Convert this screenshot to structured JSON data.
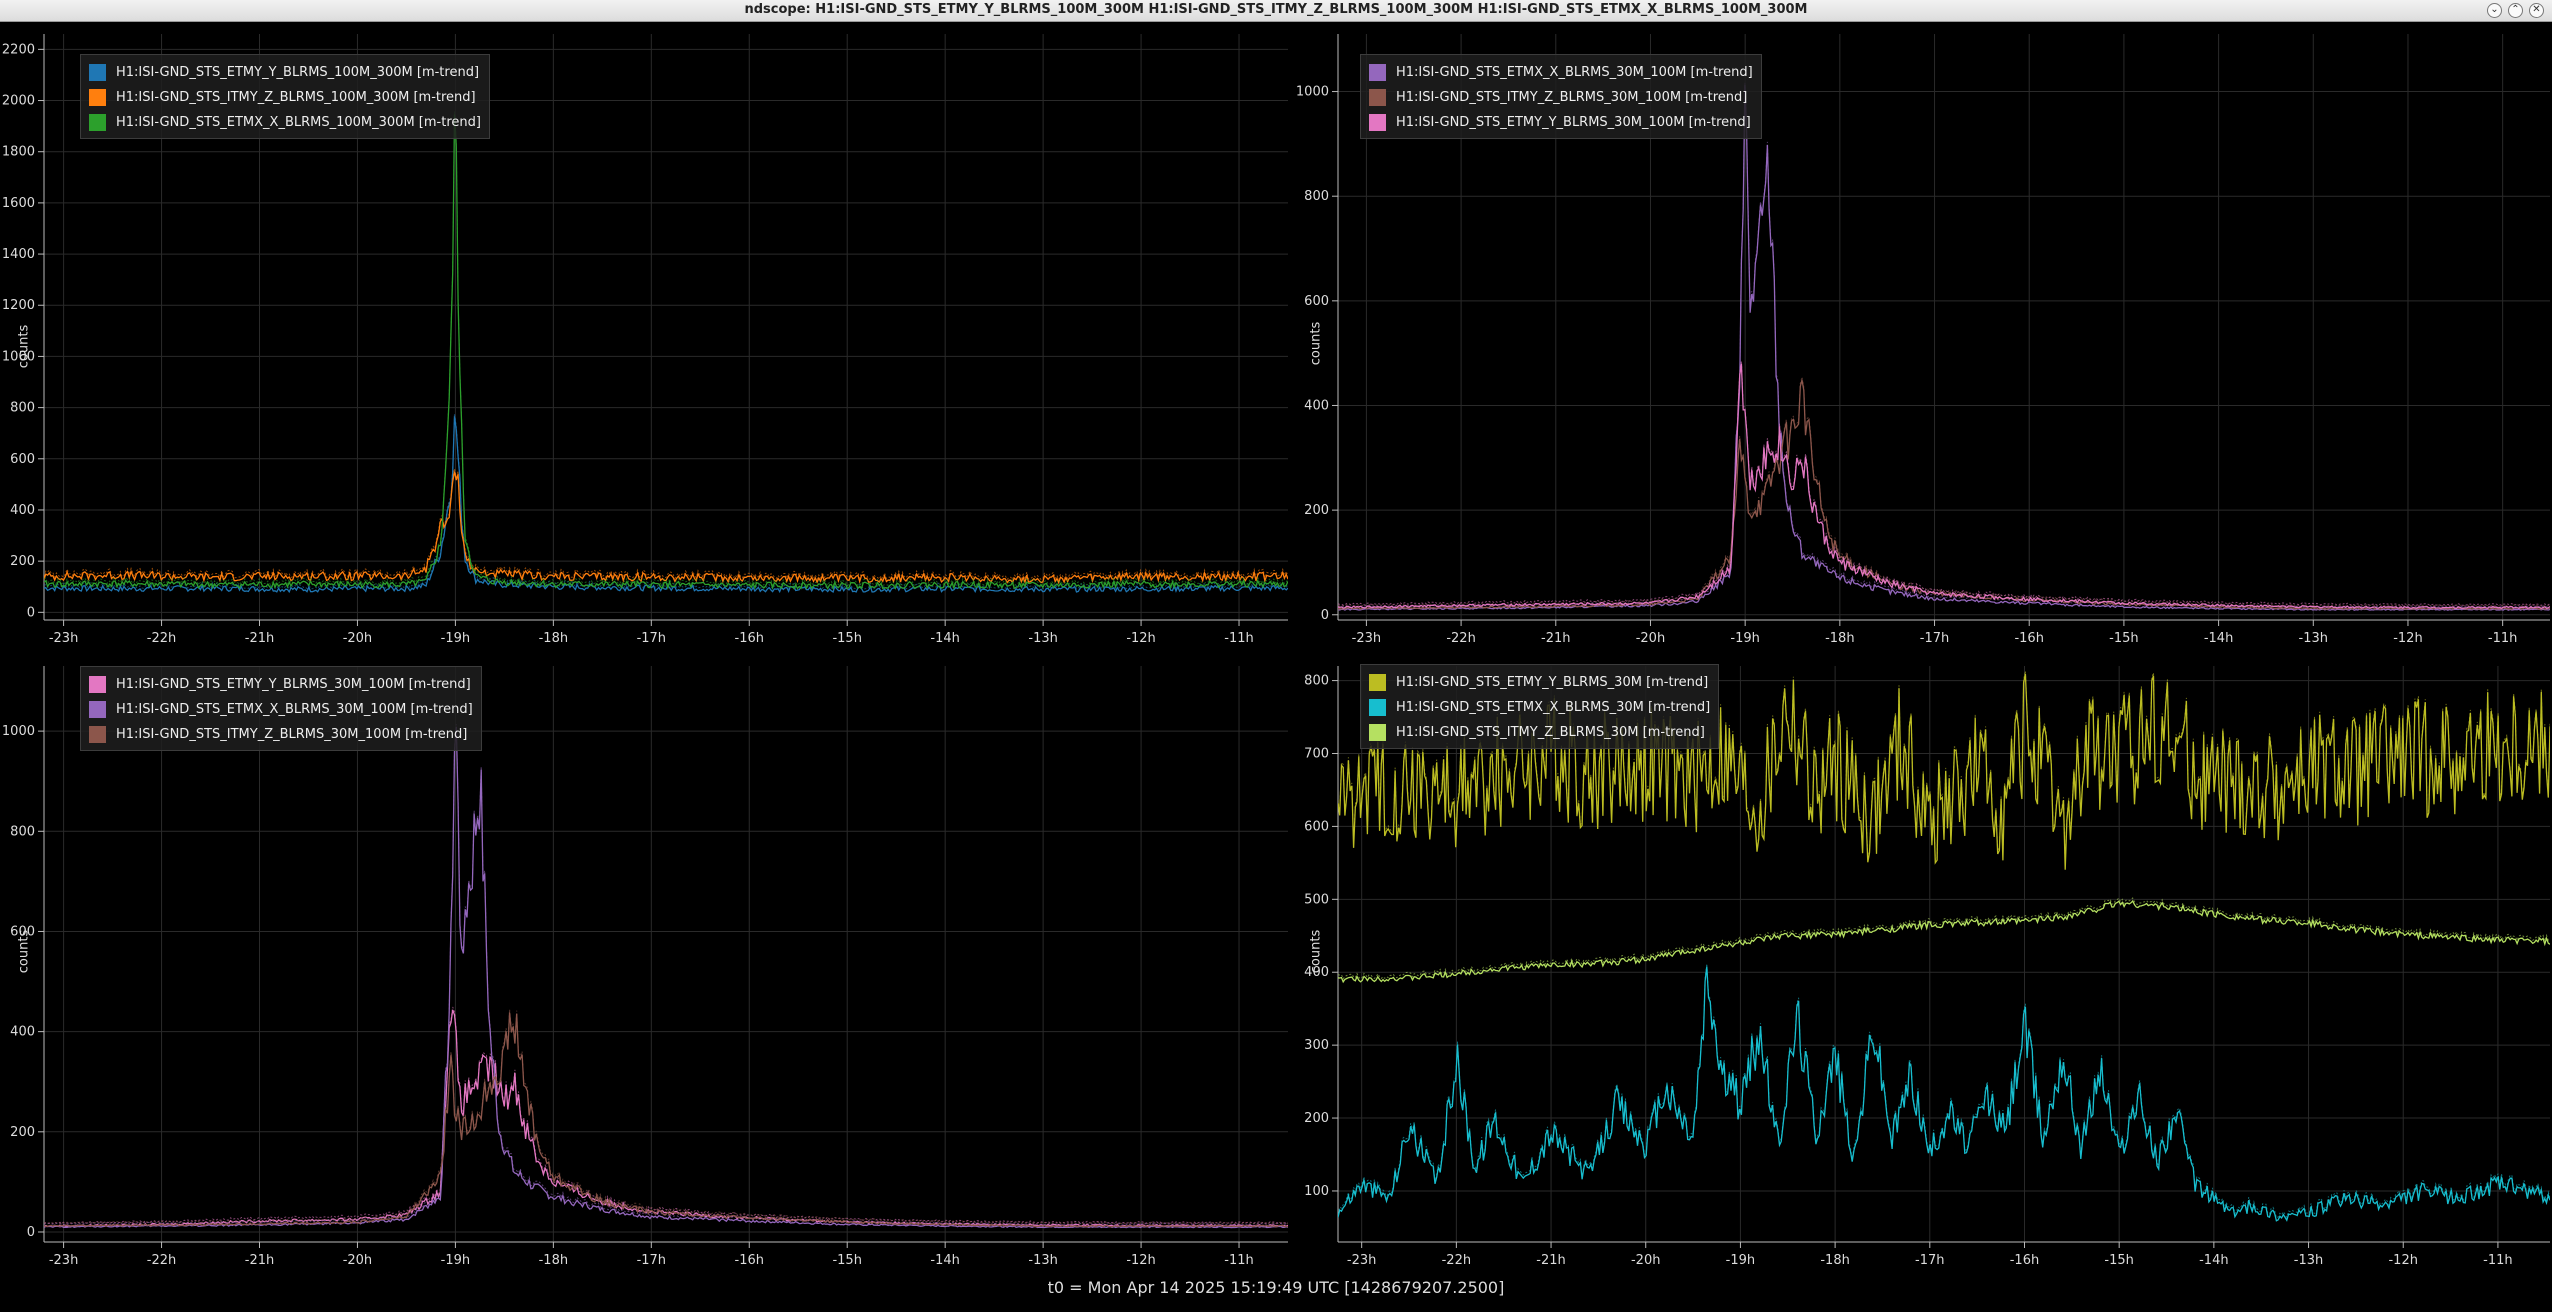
{
  "window": {
    "title": "ndscope: H1:ISI-GND_STS_ETMY_Y_BLRMS_100M_300M H1:ISI-GND_STS_ITMY_Z_BLRMS_100M_300M H1:ISI-GND_STS_ETMX_X_BLRMS_100M_300M",
    "buttons": [
      "⌄",
      "⌃",
      "✕"
    ]
  },
  "footer": "t0 = Mon Apr 14 2025 15:19:49 UTC [1428679207.2500]",
  "chart_data": [
    {
      "type": "line",
      "ylabel": "counts",
      "xlim": [
        -23.2,
        -10.5
      ],
      "ylim": [
        -30,
        2260
      ],
      "x_ticks": [
        -23,
        -22,
        -21,
        -20,
        -19,
        -18,
        -17,
        -16,
        -15,
        -14,
        -13,
        -12,
        -11
      ],
      "x_tick_labels": [
        "-23h",
        "-22h",
        "-21h",
        "-20h",
        "-19h",
        "-18h",
        "-17h",
        "-16h",
        "-15h",
        "-14h",
        "-13h",
        "-12h",
        "-11h"
      ],
      "y_ticks": [
        0,
        200,
        400,
        600,
        800,
        1000,
        1200,
        1400,
        1600,
        1800,
        2000,
        2200
      ],
      "grid": true,
      "legend": "top-left",
      "series": [
        {
          "name": "H1:ISI-GND_STS_ETMY_Y_BLRMS_100M_300M [m-trend]",
          "color": "#1f77b4",
          "x": [
            -23.2,
            -22.5,
            -21.5,
            -20.5,
            -19.5,
            -19.3,
            -19.15,
            -19.05,
            -19.0,
            -18.95,
            -18.9,
            -18.8,
            -18.6,
            -18.0,
            -17.0,
            -16.0,
            -15.0,
            -14.0,
            -13.0,
            -12.0,
            -10.5
          ],
          "y": [
            95,
            92,
            94,
            90,
            93,
            105,
            240,
            470,
            780,
            450,
            210,
            130,
            110,
            100,
            95,
            92,
            90,
            92,
            90,
            92,
            95
          ]
        },
        {
          "name": "H1:ISI-GND_STS_ITMY_Z_BLRMS_100M_300M [m-trend]",
          "color": "#ff7f0e",
          "x": [
            -23.2,
            -22.5,
            -21.5,
            -20.5,
            -19.5,
            -19.3,
            -19.15,
            -19.05,
            -19.0,
            -18.95,
            -18.9,
            -18.8,
            -18.6,
            -18.0,
            -17.0,
            -16.0,
            -15.0,
            -14.0,
            -13.0,
            -12.0,
            -10.5
          ],
          "y": [
            140,
            145,
            138,
            142,
            140,
            170,
            330,
            380,
            620,
            400,
            220,
            160,
            150,
            140,
            138,
            135,
            132,
            135,
            130,
            138,
            140
          ]
        },
        {
          "name": "H1:ISI-GND_STS_ETMX_X_BLRMS_100M_300M [m-trend]",
          "color": "#2ca02c",
          "x": [
            -23.2,
            -22.5,
            -21.5,
            -20.5,
            -19.5,
            -19.3,
            -19.15,
            -19.05,
            -19.0,
            -18.95,
            -18.9,
            -18.8,
            -18.6,
            -18.0,
            -17.0,
            -16.0,
            -15.0,
            -14.0,
            -13.0,
            -12.0,
            -10.5
          ],
          "y": [
            110,
            112,
            108,
            110,
            108,
            120,
            260,
            900,
            1980,
            800,
            300,
            140,
            120,
            110,
            108,
            105,
            105,
            108,
            105,
            110,
            110
          ]
        }
      ]
    },
    {
      "type": "line",
      "ylabel": "counts",
      "xlim": [
        -23.3,
        -10.5
      ],
      "ylim": [
        -10,
        1110
      ],
      "x_ticks": [
        -23,
        -22,
        -21,
        -20,
        -19,
        -18,
        -17,
        -16,
        -15,
        -14,
        -13,
        -12,
        -11
      ],
      "x_tick_labels": [
        "-23h",
        "-22h",
        "-21h",
        "-20h",
        "-19h",
        "-18h",
        "-17h",
        "-16h",
        "-15h",
        "-14h",
        "-13h",
        "-12h",
        "-11h"
      ],
      "y_ticks": [
        0,
        200,
        400,
        600,
        800,
        1000
      ],
      "grid": true,
      "legend": "top-left",
      "series": [
        {
          "name": "H1:ISI-GND_STS_ETMX_X_BLRMS_30M_100M [m-trend]",
          "color": "#9467bd",
          "x": [
            -23.3,
            -22,
            -21,
            -20,
            -19.5,
            -19.15,
            -19.05,
            -19.0,
            -18.95,
            -18.85,
            -18.75,
            -18.65,
            -18.55,
            -18.4,
            -18.2,
            -18.0,
            -17.5,
            -17,
            -16,
            -15,
            -14,
            -13,
            -12,
            -10.5
          ],
          "y": [
            10,
            12,
            14,
            18,
            25,
            80,
            500,
            1000,
            600,
            700,
            860,
            400,
            200,
            120,
            90,
            70,
            45,
            30,
            22,
            15,
            12,
            10,
            10,
            10
          ]
        },
        {
          "name": "H1:ISI-GND_STS_ITMY_Z_BLRMS_30M_100M [m-trend]",
          "color": "#8c564b",
          "x": [
            -23.3,
            -22,
            -21,
            -20,
            -19.5,
            -19.15,
            -19.05,
            -19.0,
            -18.95,
            -18.8,
            -18.65,
            -18.5,
            -18.4,
            -18.3,
            -18.15,
            -18.0,
            -17.5,
            -17,
            -16,
            -15,
            -14,
            -13,
            -12,
            -10.5
          ],
          "y": [
            12,
            14,
            16,
            20,
            30,
            110,
            330,
            250,
            200,
            220,
            300,
            350,
            430,
            300,
            170,
            110,
            60,
            40,
            28,
            20,
            15,
            12,
            12,
            12
          ]
        },
        {
          "name": "H1:ISI-GND_STS_ETMY_Y_BLRMS_30M_100M [m-trend]",
          "color": "#e377c2",
          "x": [
            -23.3,
            -22,
            -21,
            -20,
            -19.5,
            -19.15,
            -19.05,
            -19.0,
            -18.95,
            -18.8,
            -18.65,
            -18.5,
            -18.4,
            -18.3,
            -18.15,
            -18.0,
            -17.5,
            -17,
            -16,
            -15,
            -14,
            -13,
            -12,
            -10.5
          ],
          "y": [
            14,
            18,
            20,
            22,
            35,
            90,
            500,
            380,
            250,
            300,
            330,
            260,
            300,
            220,
            140,
            100,
            60,
            40,
            30,
            22,
            18,
            15,
            14,
            14
          ]
        }
      ]
    },
    {
      "type": "line",
      "ylabel": "counts",
      "xlim": [
        -23.2,
        -10.5
      ],
      "ylim": [
        -20,
        1130
      ],
      "x_ticks": [
        -23,
        -22,
        -21,
        -20,
        -19,
        -18,
        -17,
        -16,
        -15,
        -14,
        -13,
        -12,
        -11
      ],
      "x_tick_labels": [
        "-23h",
        "-22h",
        "-21h",
        "-20h",
        "-19h",
        "-18h",
        "-17h",
        "-16h",
        "-15h",
        "-14h",
        "-13h",
        "-12h",
        "-11h"
      ],
      "y_ticks": [
        0,
        200,
        400,
        600,
        800,
        1000
      ],
      "grid": true,
      "legend": "top-left",
      "series": [
        {
          "name": "H1:ISI-GND_STS_ETMY_Y_BLRMS_30M_100M [m-trend]",
          "color": "#e377c2",
          "x": [
            -23.2,
            -22,
            -21,
            -20,
            -19.5,
            -19.15,
            -19.05,
            -19.0,
            -18.95,
            -18.8,
            -18.65,
            -18.5,
            -18.4,
            -18.3,
            -18.15,
            -18.0,
            -17.5,
            -17,
            -16,
            -15,
            -14,
            -13,
            -12,
            -10.5
          ],
          "y": [
            12,
            15,
            22,
            25,
            35,
            80,
            480,
            380,
            250,
            300,
            330,
            260,
            300,
            220,
            140,
            100,
            60,
            40,
            28,
            20,
            16,
            14,
            13,
            13
          ]
        },
        {
          "name": "H1:ISI-GND_STS_ETMX_X_BLRMS_30M_100M [m-trend]",
          "color": "#9467bd",
          "x": [
            -23.2,
            -22,
            -21,
            -20,
            -19.5,
            -19.15,
            -19.05,
            -19.0,
            -18.95,
            -18.85,
            -18.75,
            -18.65,
            -18.55,
            -18.4,
            -18.2,
            -18.0,
            -17.5,
            -17,
            -16,
            -15,
            -14,
            -13,
            -12,
            -10.5
          ],
          "y": [
            10,
            12,
            14,
            18,
            25,
            70,
            500,
            1080,
            600,
            700,
            900,
            400,
            200,
            120,
            90,
            70,
            45,
            30,
            22,
            15,
            12,
            10,
            10,
            10
          ]
        },
        {
          "name": "H1:ISI-GND_STS_ITMY_Z_BLRMS_30M_100M [m-trend]",
          "color": "#8c564b",
          "x": [
            -23.2,
            -22,
            -21,
            -20,
            -19.5,
            -19.15,
            -19.05,
            -19.0,
            -18.95,
            -18.8,
            -18.65,
            -18.5,
            -18.4,
            -18.3,
            -18.15,
            -18.0,
            -17.5,
            -17,
            -16,
            -15,
            -14,
            -13,
            -12,
            -10.5
          ],
          "y": [
            12,
            14,
            16,
            20,
            30,
            110,
            330,
            250,
            200,
            220,
            300,
            350,
            430,
            300,
            170,
            110,
            60,
            40,
            28,
            20,
            15,
            12,
            12,
            12
          ]
        }
      ]
    },
    {
      "type": "line",
      "ylabel": "counts",
      "xlim": [
        -23.25,
        -10.45
      ],
      "ylim": [
        30,
        820
      ],
      "x_ticks": [
        -23,
        -22,
        -21,
        -20,
        -19,
        -18,
        -17,
        -16,
        -15,
        -14,
        -13,
        -12,
        -11
      ],
      "x_tick_labels": [
        "-23h",
        "-22h",
        "-21h",
        "-20h",
        "-19h",
        "-18h",
        "-17h",
        "-16h",
        "-15h",
        "-14h",
        "-13h",
        "-12h",
        "-11h"
      ],
      "y_ticks": [
        100,
        200,
        300,
        400,
        500,
        600,
        700,
        800
      ],
      "grid": true,
      "legend": "top-left",
      "series": [
        {
          "name": "H1:ISI-GND_STS_ETMY_Y_BLRMS_30M [m-trend]",
          "color": "#bcbd22",
          "x": [
            -23.25,
            -23,
            -22.5,
            -22,
            -21.5,
            -21,
            -20.6,
            -20,
            -19.5,
            -19.2,
            -18.8,
            -18.5,
            -18.2,
            -18.0,
            -17.6,
            -17.3,
            -17.0,
            -16.5,
            -16.2,
            -16.0,
            -15.6,
            -15.3,
            -15.0,
            -14.6,
            -14.2,
            -14.0,
            -13.5,
            -13.0,
            -12.5,
            -12.0,
            -11.5,
            -11.0,
            -10.45
          ],
          "y": [
            640,
            650,
            660,
            640,
            680,
            700,
            670,
            690,
            660,
            700,
            620,
            770,
            640,
            690,
            610,
            720,
            600,
            680,
            620,
            740,
            590,
            710,
            690,
            750,
            680,
            660,
            650,
            670,
            680,
            690,
            700,
            705,
            710
          ]
        },
        {
          "name": "H1:ISI-GND_STS_ETMX_X_BLRMS_30M [m-trend]",
          "color": "#17becf",
          "x": [
            -23.25,
            -23.0,
            -22.7,
            -22.5,
            -22.2,
            -22.0,
            -21.8,
            -21.6,
            -21.3,
            -21.0,
            -20.6,
            -20.3,
            -20.0,
            -19.8,
            -19.5,
            -19.35,
            -19.2,
            -19.0,
            -18.8,
            -18.6,
            -18.4,
            -18.2,
            -18.0,
            -17.8,
            -17.6,
            -17.4,
            -17.2,
            -17.0,
            -16.8,
            -16.6,
            -16.4,
            -16.2,
            -16.0,
            -15.8,
            -15.6,
            -15.4,
            -15.2,
            -15.0,
            -14.8,
            -14.6,
            -14.4,
            -14.2,
            -14.0,
            -13.8,
            -13.6,
            -13.3,
            -13.0,
            -12.6,
            -12.2,
            -11.8,
            -11.4,
            -11.0,
            -10.7,
            -10.45
          ],
          "y": [
            70,
            110,
            90,
            190,
            110,
            280,
            130,
            200,
            110,
            180,
            120,
            220,
            160,
            240,
            170,
            390,
            260,
            220,
            320,
            160,
            340,
            180,
            290,
            140,
            330,
            170,
            260,
            150,
            210,
            160,
            230,
            180,
            330,
            170,
            290,
            160,
            270,
            150,
            230,
            140,
            210,
            110,
            90,
            70,
            80,
            65,
            70,
            90,
            80,
            100,
            90,
            110,
            100,
            90
          ]
        },
        {
          "name": "H1:ISI-GND_STS_ITMY_Z_BLRMS_30M [m-trend]",
          "color": "#b5e061",
          "x": [
            -23.25,
            -22.5,
            -22.0,
            -21.5,
            -21.0,
            -20.5,
            -20.0,
            -19.5,
            -19.0,
            -18.5,
            -18.0,
            -17.5,
            -17.0,
            -16.5,
            -16.0,
            -15.5,
            -15.0,
            -14.5,
            -14.0,
            -13.5,
            -13.0,
            -12.5,
            -12.0,
            -11.5,
            -11.0,
            -10.45
          ],
          "y": [
            390,
            392,
            398,
            405,
            410,
            412,
            418,
            430,
            440,
            450,
            452,
            458,
            465,
            468,
            470,
            478,
            495,
            490,
            480,
            472,
            468,
            458,
            452,
            448,
            444,
            442
          ]
        }
      ]
    }
  ]
}
